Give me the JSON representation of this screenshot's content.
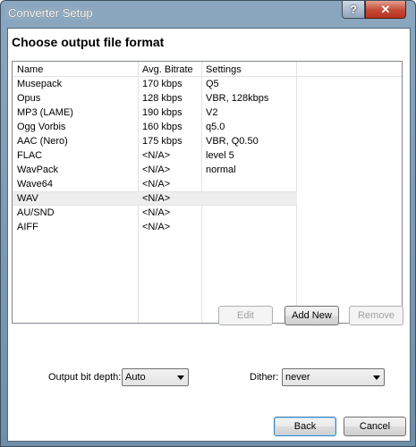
{
  "window": {
    "title": "Converter Setup",
    "help_label": "?",
    "close_label": "✕"
  },
  "heading": "Choose output file format",
  "columns": {
    "name": "Name",
    "bitrate": "Avg. Bitrate",
    "settings": "Settings"
  },
  "formats": [
    {
      "name": "Musepack",
      "bitrate": "170 kbps",
      "settings": "Q5"
    },
    {
      "name": "Opus",
      "bitrate": "128 kbps",
      "settings": "VBR, 128kbps"
    },
    {
      "name": "MP3 (LAME)",
      "bitrate": "190 kbps",
      "settings": "V2"
    },
    {
      "name": "Ogg Vorbis",
      "bitrate": "160 kbps",
      "settings": "q5.0"
    },
    {
      "name": "AAC (Nero)",
      "bitrate": "175 kbps",
      "settings": "VBR, Q0.50"
    },
    {
      "name": "FLAC",
      "bitrate": "<N/A>",
      "settings": "level 5"
    },
    {
      "name": "WavPack",
      "bitrate": "<N/A>",
      "settings": "normal"
    },
    {
      "name": "Wave64",
      "bitrate": "<N/A>",
      "settings": ""
    },
    {
      "name": "WAV",
      "bitrate": "<N/A>",
      "settings": ""
    },
    {
      "name": "AU/SND",
      "bitrate": "<N/A>",
      "settings": ""
    },
    {
      "name": "AIFF",
      "bitrate": "<N/A>",
      "settings": ""
    }
  ],
  "selected_format": "WAV",
  "buttons": {
    "edit": "Edit",
    "add_new": "Add New",
    "remove": "Remove",
    "back": "Back",
    "cancel": "Cancel"
  },
  "bit_depth": {
    "label": "Output bit depth:",
    "value": "Auto"
  },
  "dither": {
    "label": "Dither:",
    "value": "never"
  }
}
